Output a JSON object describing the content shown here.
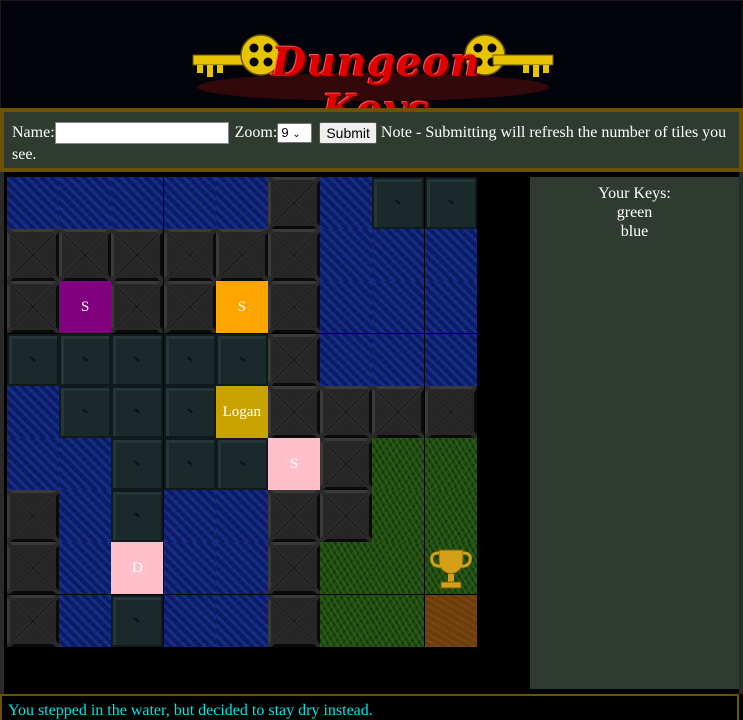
{
  "header": {
    "logo_text": "Dungeon Keys"
  },
  "form": {
    "name_label": "Name:",
    "name_value": "",
    "name_placeholder": "",
    "zoom_label": "Zoom:",
    "zoom_value": "9",
    "submit_label": "Submit",
    "note": "Note - Submitting will refresh the number of tiles you see."
  },
  "board": {
    "cols": 9,
    "rows": 9,
    "tiles": [
      [
        "water",
        "water",
        "water",
        "water",
        "water",
        "wall",
        "water",
        "floor",
        "floor"
      ],
      [
        "wall",
        "wall",
        "wall",
        "wall",
        "wall",
        "wall",
        "water",
        "water",
        "water"
      ],
      [
        "wall",
        "wall",
        "wall",
        "wall",
        "wall",
        "wall",
        "water",
        "water",
        "water"
      ],
      [
        "floor",
        "floor",
        "floor",
        "floor",
        "floor",
        "wall",
        "water",
        "water",
        "water"
      ],
      [
        "water",
        "floor",
        "floor",
        "floor",
        "floor",
        "wall",
        "wall",
        "wall",
        "wall"
      ],
      [
        "water",
        "water",
        "floor",
        "floor",
        "floor",
        "wall",
        "wall",
        "grass",
        "grass"
      ],
      [
        "wall",
        "water",
        "floor",
        "water",
        "water",
        "wall",
        "wall",
        "grass",
        "grass"
      ],
      [
        "wall",
        "water",
        "water",
        "water",
        "water",
        "wall",
        "grass",
        "grass",
        "grass"
      ],
      [
        "wall",
        "water",
        "floor",
        "water",
        "water",
        "wall",
        "grass",
        "grass",
        "dirt"
      ]
    ],
    "markers": [
      {
        "row": 2,
        "col": 1,
        "label": "S",
        "color": "#800080"
      },
      {
        "row": 2,
        "col": 4,
        "label": "S",
        "color": "#ffa500"
      },
      {
        "row": 4,
        "col": 4,
        "label": "Logan",
        "color": "#c9a400"
      },
      {
        "row": 5,
        "col": 5,
        "label": "S",
        "color": "#ffc0cb"
      },
      {
        "row": 7,
        "col": 2,
        "label": "D",
        "color": "#ffc0cb"
      }
    ],
    "items": [
      {
        "row": 7,
        "col": 8,
        "icon": "trophy-icon",
        "color": "#d4a017"
      }
    ]
  },
  "keys_panel": {
    "title": "Your Keys:",
    "keys": [
      "green",
      "blue"
    ]
  },
  "status": {
    "message": "You stepped in the water, but decided to stay dry instead.",
    "color": "#00e5e5"
  }
}
